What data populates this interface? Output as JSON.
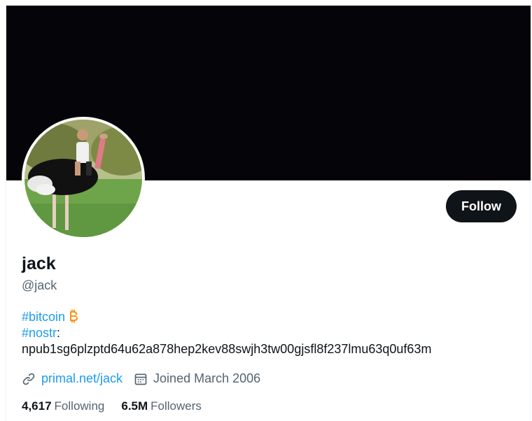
{
  "profile": {
    "name": "jack",
    "handle": "@jack",
    "follow_label": "Follow",
    "avatar_icon": "profile-photo-ostrich",
    "banner_color": "#050409"
  },
  "bio": {
    "tag_bitcoin": "#bitcoin",
    "bitcoin_icon": "bitcoin-icon",
    "tag_nostr": "#nostr",
    "nostr_suffix": ":",
    "npub": "npub1sg6plzptd64u62a878hep2kev88swjh3tw00gjsfl8f237lmu63q0uf63m"
  },
  "meta": {
    "website": "primal.net/jack",
    "joined": "Joined March 2006"
  },
  "stats": {
    "following_count": "4,617",
    "following_label": "Following",
    "followers_count": "6.5M",
    "followers_label": "Followers"
  },
  "colors": {
    "accent": "#1d9bf0",
    "text": "#0f1419",
    "secondary_text": "#536471",
    "bitcoin": "#f7931a"
  }
}
